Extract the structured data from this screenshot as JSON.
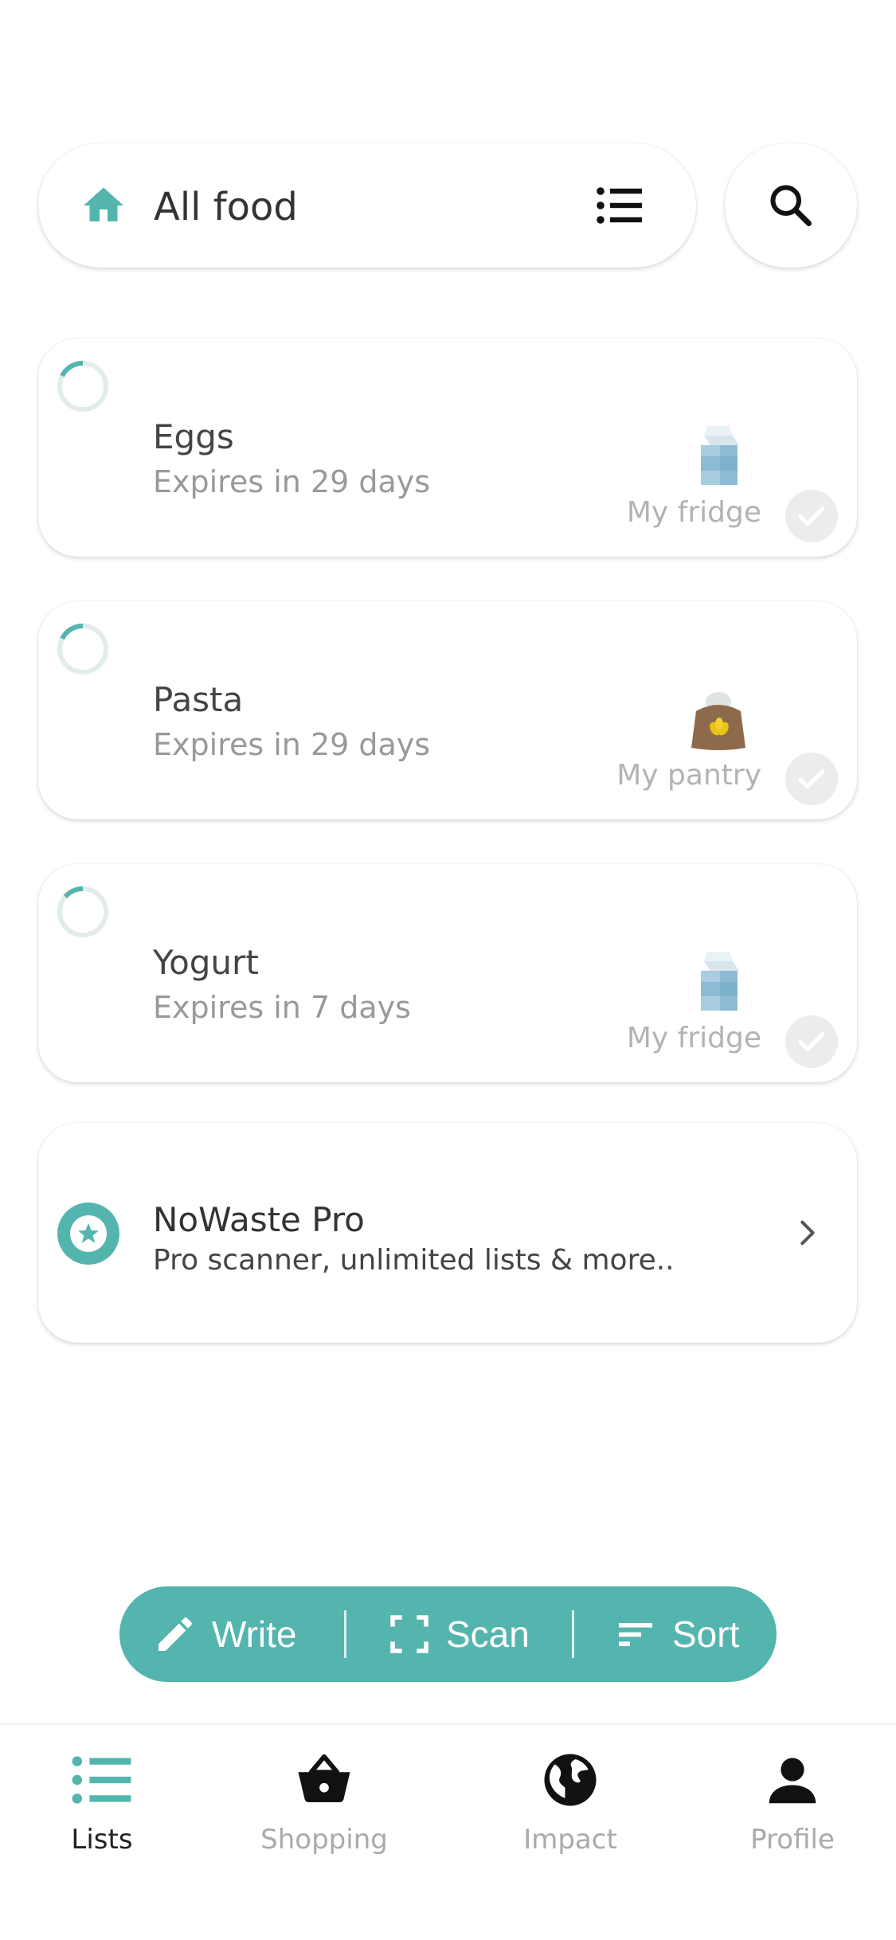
{
  "colors": {
    "accent": "#53b5ad",
    "text_muted": "#999999",
    "divider": "#ececec"
  },
  "header": {
    "home_icon": "home-icon",
    "list_title": "All food",
    "menu_icon": "list-menu-icon",
    "search_icon": "search-icon"
  },
  "items": [
    {
      "name": "Eggs",
      "expiry": "Expires in 29 days",
      "location": "My fridge",
      "icon": "milk-carton-icon"
    },
    {
      "name": "Pasta",
      "expiry": "Expires in 29 days",
      "location": "My pantry",
      "icon": "grain-sack-icon"
    },
    {
      "name": "Yogurt",
      "expiry": "Expires in 7 days",
      "location": "My fridge",
      "icon": "milk-carton-icon"
    }
  ],
  "promo": {
    "title": "NoWaste Pro",
    "subtitle": "Pro scanner, unlimited lists & more..",
    "icon": "star-badge-icon"
  },
  "actions": {
    "write": "Write",
    "scan": "Scan",
    "sort": "Sort"
  },
  "nav": {
    "lists": "Lists",
    "shopping": "Shopping",
    "impact": "Impact",
    "profile": "Profile",
    "active": "lists"
  }
}
